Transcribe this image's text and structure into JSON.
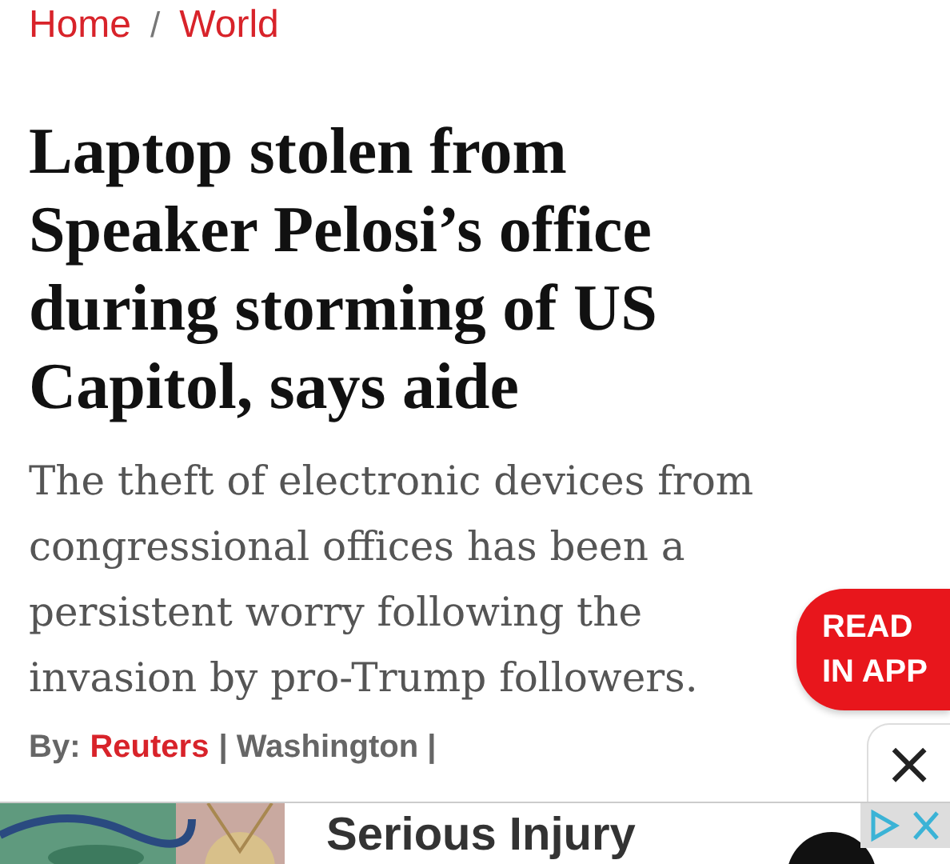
{
  "breadcrumb": [
    {
      "label": "Home"
    },
    {
      "label": "World"
    }
  ],
  "breadcrumb_separator": "/",
  "headline": "Laptop stolen from Speaker Pelosi’s office during storming of US Capitol, says aide",
  "summary": "The theft of electronic devices from congressional offices has been a persistent worry following the invasion by pro-Trump followers.",
  "read_in_app": "READ IN APP",
  "close": "×",
  "byline": {
    "prefix": "By:",
    "author": "Reuters",
    "location": "| Washington |"
  },
  "ad": {
    "title": "Serious Injury"
  }
}
